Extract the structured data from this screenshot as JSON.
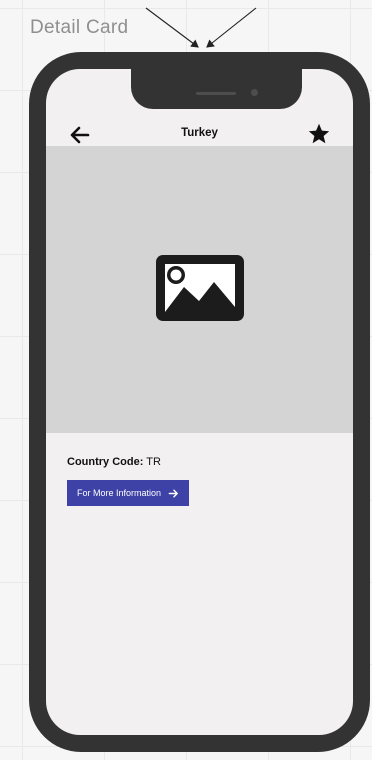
{
  "canvas": {
    "label": "Detail Card"
  },
  "header": {
    "title": "Turkey",
    "back_icon": "arrow-left-icon",
    "favorite_icon": "star-icon"
  },
  "hero": {
    "icon": "image-placeholder-icon"
  },
  "details": {
    "country_code_label": "Country Code:",
    "country_code_value": "TR"
  },
  "actions": {
    "more_info_label": "For More Information",
    "more_info_icon": "arrow-right-icon"
  },
  "colors": {
    "button": "#3e42a6",
    "hero_background": "#d4d4d4",
    "device_frame": "#333333",
    "screen_background": "#f2f0f1"
  }
}
